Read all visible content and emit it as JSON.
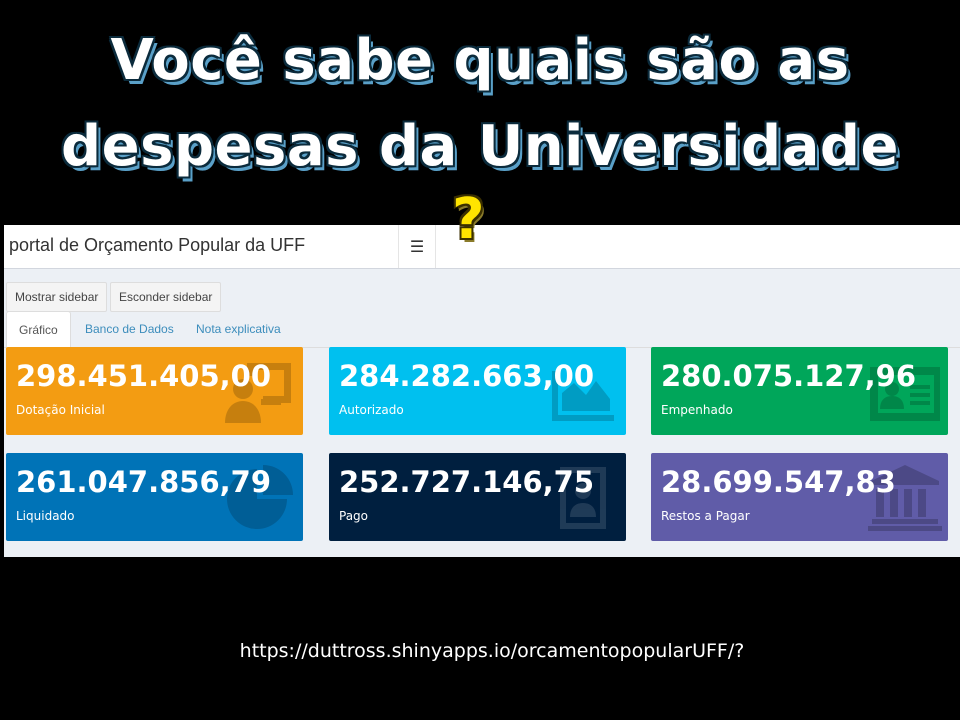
{
  "slide": {
    "headline_line1": "Você sabe quais são as",
    "headline_line2": "despesas da Universidade",
    "question_mark": "?",
    "url": "https://duttross.shinyapps.io/orcamentopopularUFF/?"
  },
  "app": {
    "title": "portal de Orçamento Popular da UFF",
    "menu_icon": "☰",
    "buttons": {
      "show_sidebar": "Mostrar sidebar",
      "hide_sidebar": "Esconder sidebar"
    },
    "tabs": [
      {
        "label": "Gráfico",
        "active": true
      },
      {
        "label": "Banco de Dados",
        "active": false
      },
      {
        "label": "Nota explicativa",
        "active": false
      }
    ]
  },
  "value_boxes": [
    {
      "value": "298.451.405,00",
      "label": "Dotação Inicial",
      "color": "#f39c12",
      "icon": "presentation-icon"
    },
    {
      "value": "284.282.663,00",
      "label": "Autorizado",
      "color": "#00c0ef",
      "icon": "area-chart-icon"
    },
    {
      "value": "280.075.127,96",
      "label": "Empenhado",
      "color": "#00a65a",
      "icon": "id-card-icon"
    },
    {
      "value": "261.047.856,79",
      "label": "Liquidado",
      "color": "#0073b7",
      "icon": "pie-chart-icon"
    },
    {
      "value": "252.727.146,75",
      "label": "Pago",
      "color": "#001f3f",
      "icon": "user-badge-icon"
    },
    {
      "value": "28.699.547,83",
      "label": "Restos a Pagar",
      "color": "#605ca8",
      "icon": "bank-icon"
    }
  ]
}
